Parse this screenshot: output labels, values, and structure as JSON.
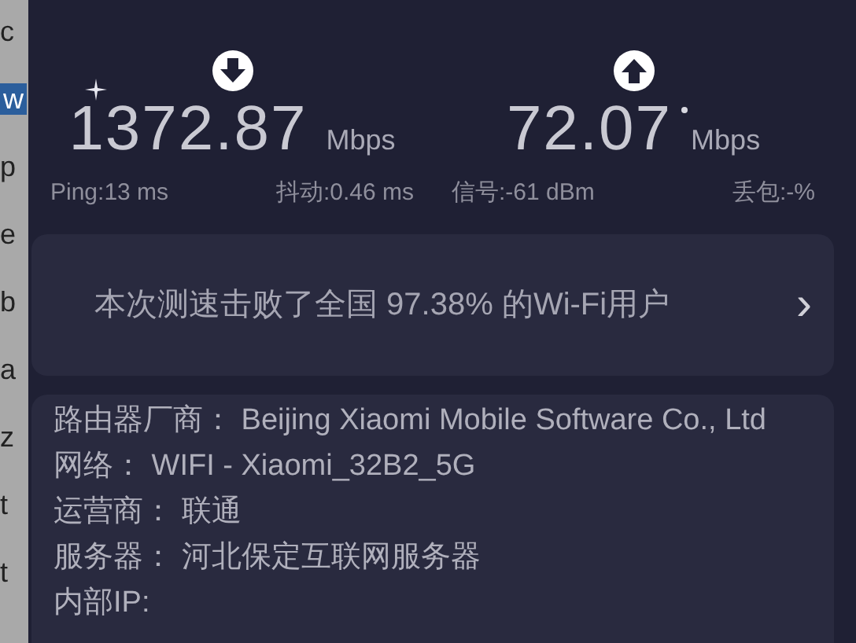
{
  "background_fragments": [
    {
      "text": "c",
      "selected": false
    },
    {
      "text": "w",
      "selected": true
    },
    {
      "text": "p",
      "selected": false
    },
    {
      "text": "e",
      "selected": false
    },
    {
      "text": "b",
      "selected": false
    },
    {
      "text": "a",
      "selected": false
    },
    {
      "text": "z",
      "selected": false
    },
    {
      "text": "t",
      "selected": false
    },
    {
      "text": "t",
      "selected": false
    }
  ],
  "speeds": [
    {
      "kind": "download",
      "value": "1372.87",
      "unit": "Mbps",
      "stats": [
        "Ping:13 ms",
        "抖动:0.46 ms"
      ]
    },
    {
      "kind": "upload",
      "value": "72.07",
      "unit": "Mbps",
      "stats": [
        "信号:-61 dBm",
        "丢包:-%"
      ]
    }
  ],
  "result_banner": {
    "text": "本次测速击败了全国 97.38% 的Wi-Fi用户",
    "chevron": "›"
  },
  "info": [
    {
      "label": "路由器厂商：",
      "value": "Beijing Xiaomi Mobile Software Co., Ltd"
    },
    {
      "label": "网络：",
      "value": "WIFI - Xiaomi_32B2_5G"
    },
    {
      "label": "运营商：",
      "value": "联通"
    },
    {
      "label": "服务器：",
      "value": "河北保定互联网服务器"
    },
    {
      "label": "内部IP:"
    }
  ]
}
